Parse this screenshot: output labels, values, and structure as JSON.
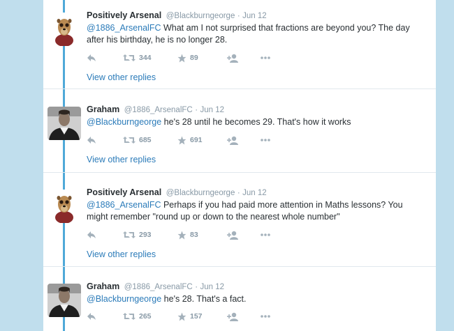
{
  "accent": "#2b7bb9",
  "thread_line_color": "#4fa9d8",
  "tweets": [
    {
      "avatar": "meerkat-avatar",
      "name": "Positively Arsenal",
      "handle": "@Blackburngeorge",
      "dot": "·",
      "date": "Jun 12",
      "mention": "@1886_ArsenalFC",
      "text": " What am I not surprised that fractions are beyond you? The day after his birthday, he is no longer 28.",
      "retweets": "344",
      "favorites": "89",
      "view_replies": "View other replies"
    },
    {
      "avatar": "player-photo-avatar",
      "name": "Graham",
      "handle": "@1886_ArsenalFC",
      "dot": "·",
      "date": "Jun 12",
      "mention": "@Blackburngeorge",
      "text": " he's 28 until he becomes 29. That's how it works",
      "retweets": "685",
      "favorites": "691",
      "view_replies": "View other replies"
    },
    {
      "avatar": "meerkat-avatar",
      "name": "Positively Arsenal",
      "handle": "@Blackburngeorge",
      "dot": "·",
      "date": "Jun 12",
      "mention": "@1886_ArsenalFC",
      "text": " Perhaps if you had paid more attention in Maths lessons? You might remember \"round up or down to the nearest whole number\"",
      "retweets": "293",
      "favorites": "83",
      "view_replies": "View other replies"
    },
    {
      "avatar": "player-photo-avatar",
      "name": "Graham",
      "handle": "@1886_ArsenalFC",
      "dot": "·",
      "date": "Jun 12",
      "mention": "@Blackburngeorge",
      "text": " he's 28. That's a fact.",
      "retweets": "265",
      "favorites": "157"
    }
  ]
}
